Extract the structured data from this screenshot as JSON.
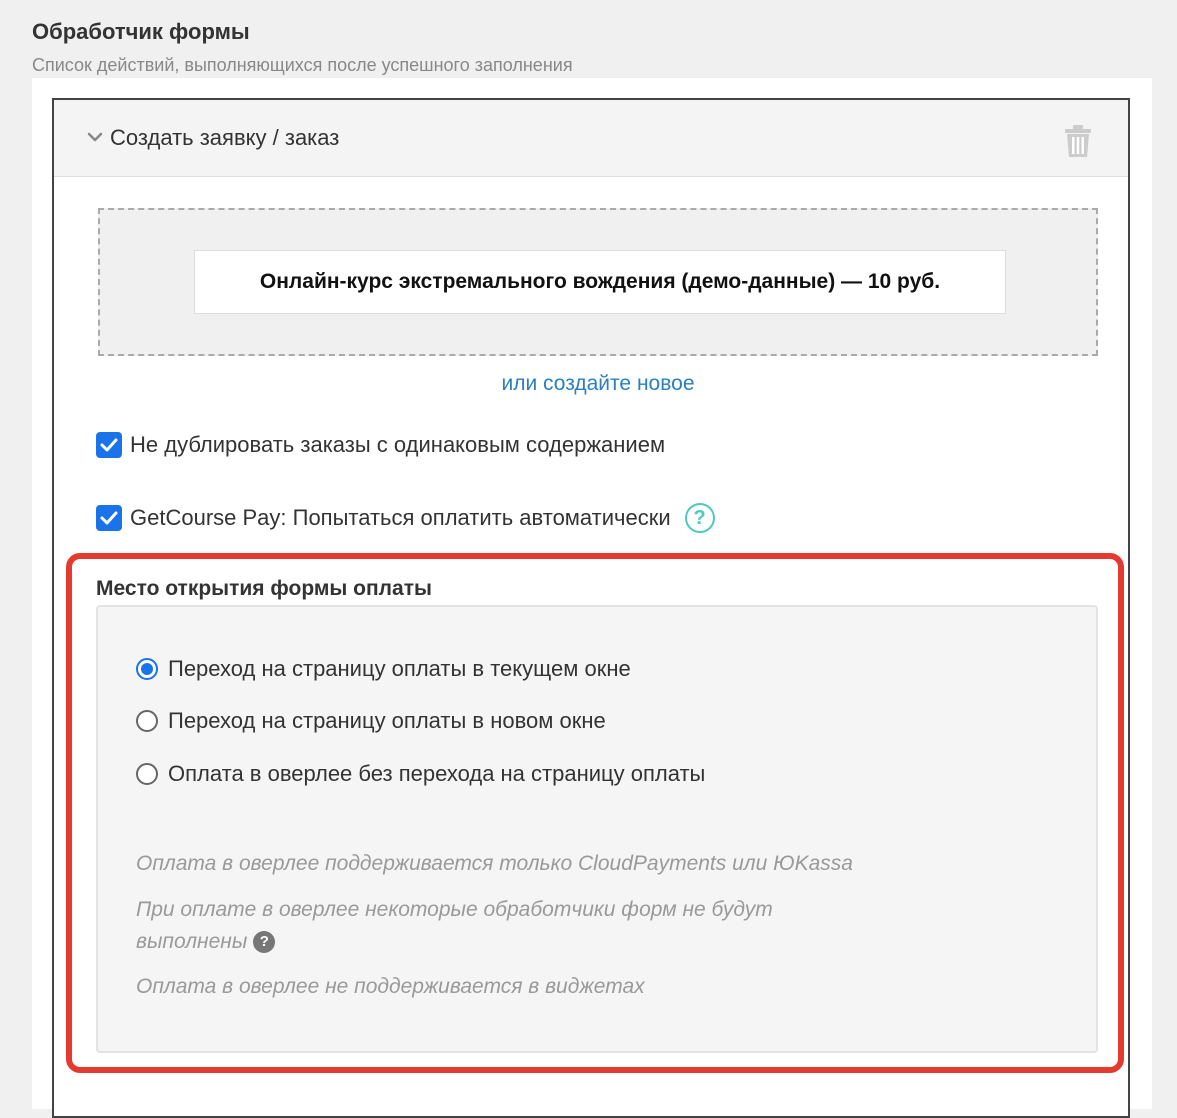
{
  "section": {
    "title": "Обработчик формы",
    "subtitle": "Список действий, выполняющихся после успешного заполнения"
  },
  "action": {
    "title": "Создать заявку / заказ",
    "offer": "Онлайн-курс экстремального вождения (демо-данные) — 10 руб.",
    "create_link": "или создайте новое",
    "no_duplicate_label": "Не дублировать заказы с одинаковым содержанием",
    "no_duplicate_checked": true,
    "autopay_label": "GetCourse Pay: Попытаться оплатить автоматически",
    "autopay_checked": true,
    "help_symbol": "?"
  },
  "payment": {
    "title": "Место открытия формы оплаты",
    "options": [
      {
        "label": "Переход на страницу оплаты в текущем окне",
        "selected": true
      },
      {
        "label": "Переход на страницу оплаты в новом окне",
        "selected": false
      },
      {
        "label": "Оплата в оверлее без перехода на страницу оплаты",
        "selected": false
      }
    ],
    "notes": {
      "n1": "Оплата в оверлее поддерживается только CloudPayments или ЮKassa",
      "n2_line1": "При оплате в оверлее некоторые обработчики форм не будут",
      "n2_line2": "выполнены",
      "n3": "Оплата в оверлее не поддерживается в виджетах"
    },
    "help_symbol": "?"
  },
  "colors": {
    "accent": "#1a73e8",
    "link": "#2a7fc1",
    "highlight": "#e53a2f",
    "help": "#4cc9c0"
  },
  "icons": {
    "chevron": "chevron-down-icon",
    "trash": "trash-icon",
    "check": "check-icon",
    "help": "help-icon"
  }
}
